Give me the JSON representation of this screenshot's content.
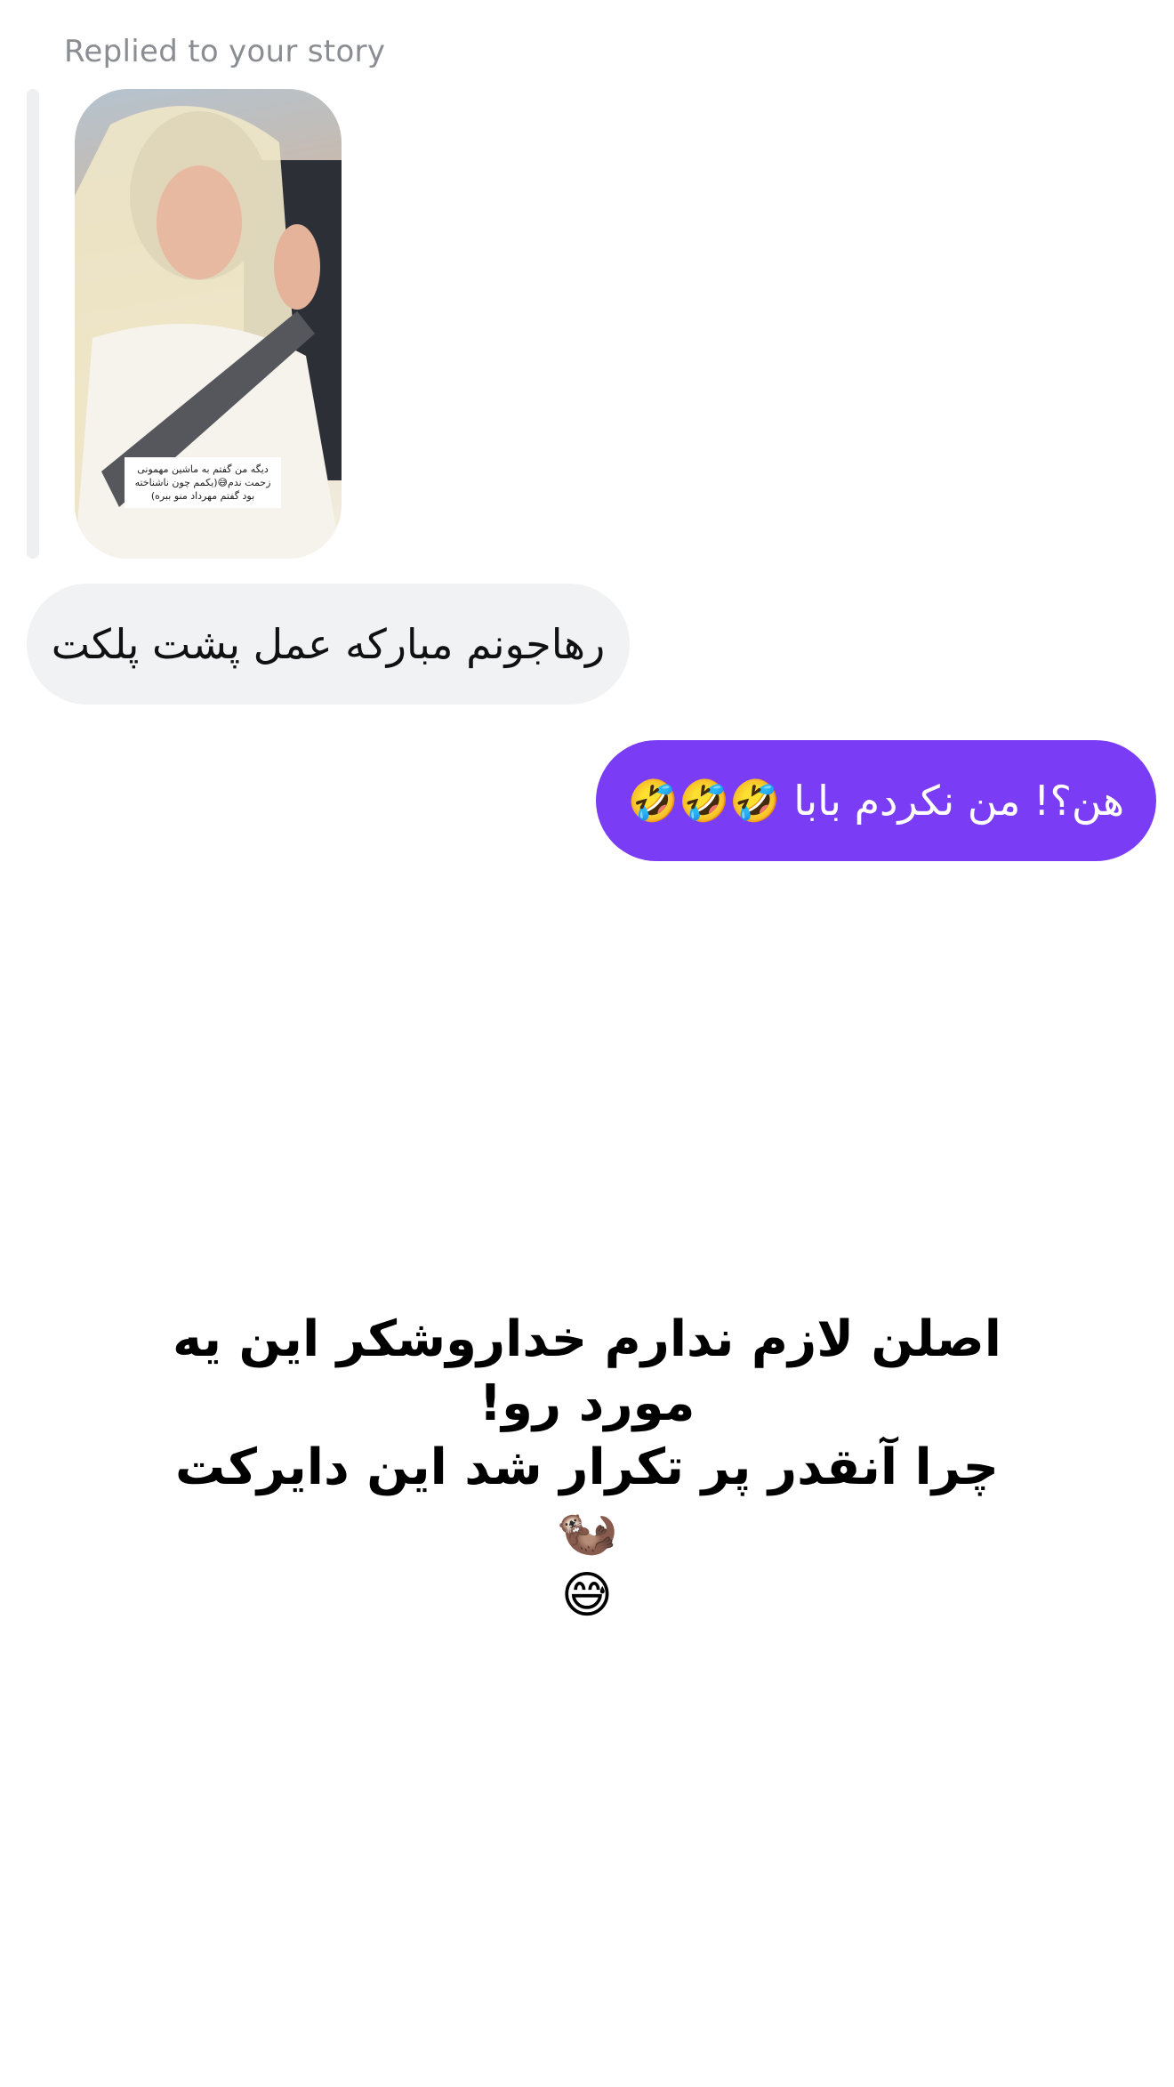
{
  "thread": {
    "reply_caption": "Replied to your story",
    "story": {
      "caption": "دیگه من گفتم به ماشین مهمونی زحمت ندم😅(یکمم چون ناشناخته بود گفتم مهرداد منو ببره)"
    },
    "messages": [
      {
        "direction": "incoming",
        "text": "رهاجونم مبارکه عمل پشت پلکت"
      },
      {
        "direction": "outgoing",
        "text": "هن؟! من نکردم بابا 🤣🤣🤣"
      }
    ]
  },
  "overlay": {
    "text": "اصلن لازم ندارم خداروشکر این یه\nمورد رو!\nچرا آنقدر پر تکرار شد این دایرکت🦦\n😅"
  },
  "colors": {
    "outgoing_bubble": "#7a3cf5",
    "incoming_bubble": "#f1f2f4",
    "caption_gray": "#8a8d91"
  }
}
